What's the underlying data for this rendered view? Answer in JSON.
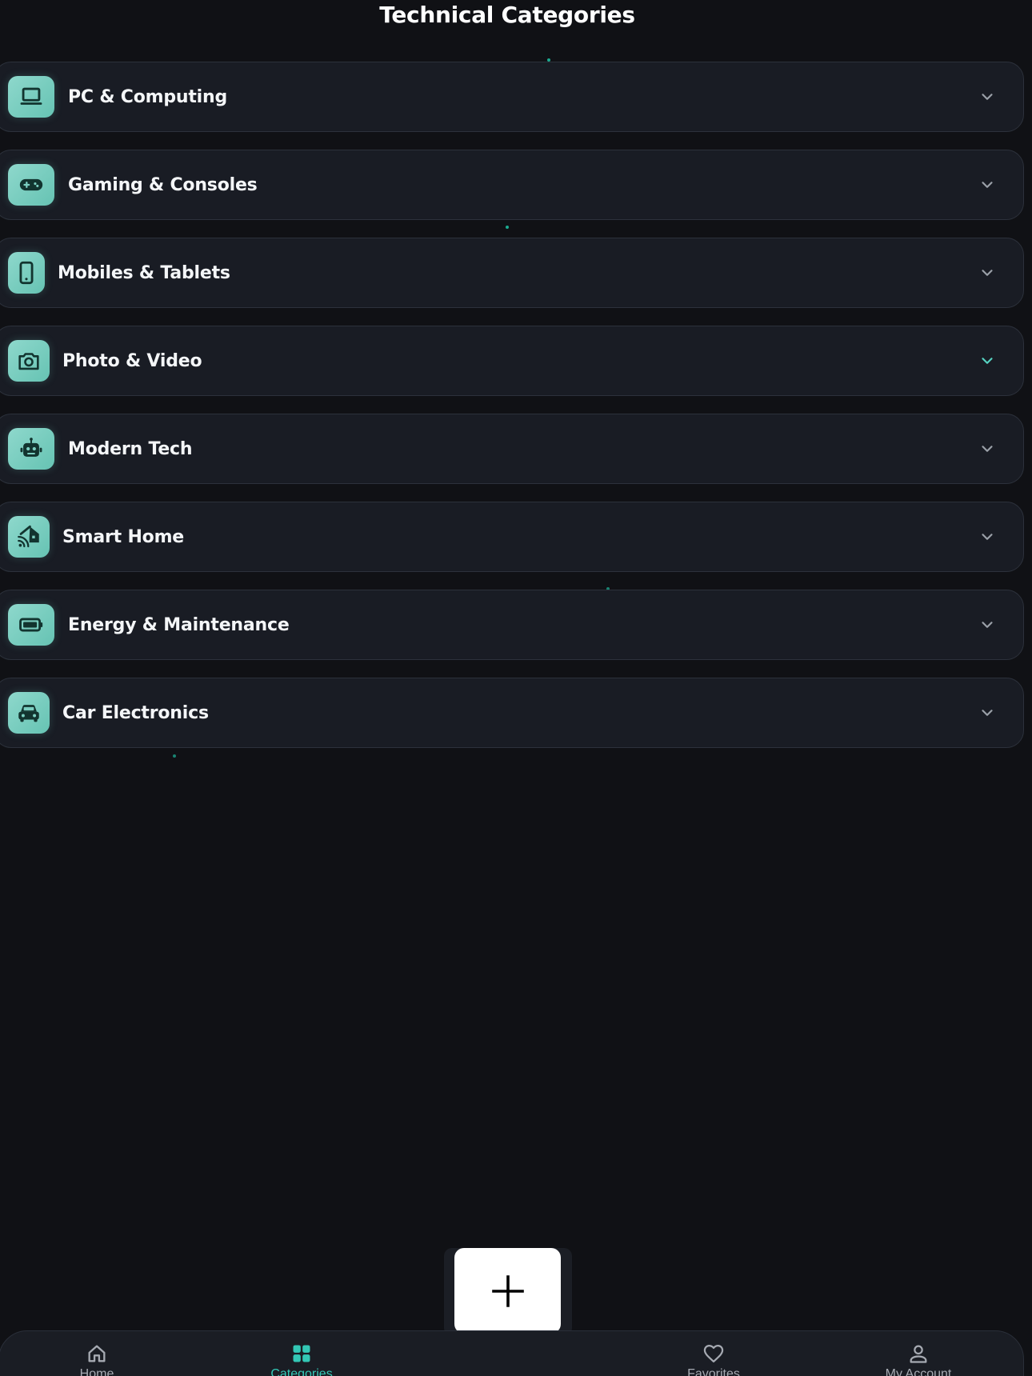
{
  "page": {
    "title": "Technical Categories"
  },
  "categories": [
    {
      "label": "PC & Computing",
      "icon": "laptop-icon"
    },
    {
      "label": "Gaming & Consoles",
      "icon": "gamepad-icon"
    },
    {
      "label": "Mobiles & Tablets",
      "icon": "smartphone-icon"
    },
    {
      "label": "Photo & Video",
      "icon": "camera-icon"
    },
    {
      "label": "Modern Tech",
      "icon": "robot-icon"
    },
    {
      "label": "Smart Home",
      "icon": "smart-home-icon"
    },
    {
      "label": "Energy & Maintenance",
      "icon": "battery-icon"
    },
    {
      "label": "Car Electronics",
      "icon": "car-icon"
    }
  ],
  "fab": {
    "icon": "plus-icon"
  },
  "bottom_nav": {
    "items": [
      {
        "label": "Home",
        "icon": "home-icon",
        "active": false
      },
      {
        "label": "Categories",
        "icon": "grid-icon",
        "active": true
      },
      {
        "label": "Favorites",
        "icon": "heart-icon",
        "active": false
      },
      {
        "label": "My Account",
        "icon": "person-icon",
        "active": false
      }
    ]
  },
  "colors": {
    "background": "#101115",
    "card": "#191c24",
    "accent": "#33c7b5",
    "icon_tile": "#7ccfc1"
  }
}
